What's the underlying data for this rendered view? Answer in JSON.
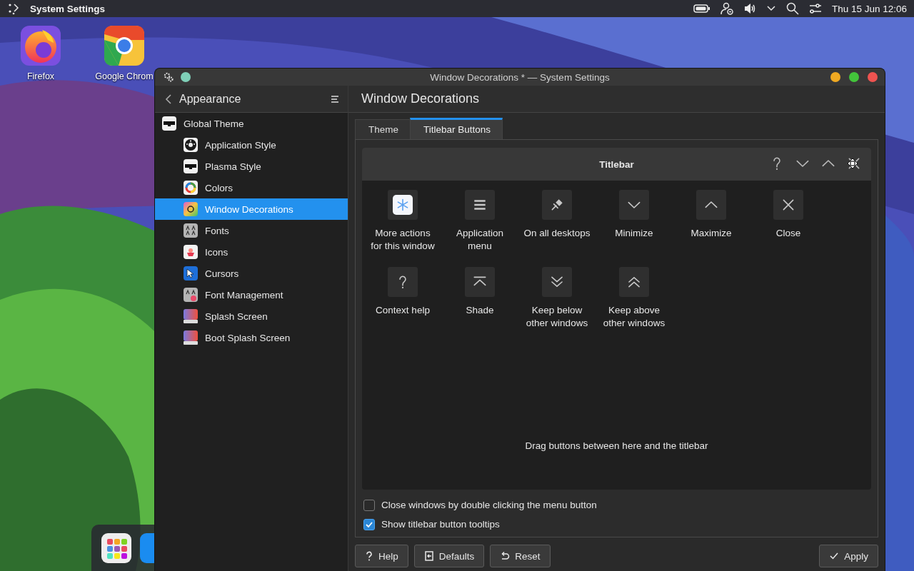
{
  "panel": {
    "app_title": "System Settings",
    "clock": "Thu 15 Jun 12:06"
  },
  "desktop_icons": [
    {
      "label": "Firefox",
      "kind": "firefox"
    },
    {
      "label": "Google Chrom",
      "kind": "chrome"
    }
  ],
  "window": {
    "title": "Window Decorations * — System Settings"
  },
  "sidebar": {
    "title": "Appearance",
    "items": [
      {
        "label": "Global Theme",
        "kind": "global",
        "selected": false,
        "children": [
          {
            "label": "Application Style",
            "kind": "appstyle",
            "selected": false
          },
          {
            "label": "Plasma Style",
            "kind": "global",
            "selected": false
          },
          {
            "label": "Colors",
            "kind": "colors",
            "selected": false
          },
          {
            "label": "Window Decorations",
            "kind": "decorations",
            "selected": true
          },
          {
            "label": "Fonts",
            "kind": "fonts",
            "selected": false
          },
          {
            "label": "Icons",
            "kind": "icons",
            "selected": false
          },
          {
            "label": "Cursors",
            "kind": "cursors",
            "selected": false
          },
          {
            "label": "Font Management",
            "kind": "fontmgmt",
            "selected": false
          },
          {
            "label": "Splash Screen",
            "kind": "splash",
            "selected": false
          },
          {
            "label": "Boot Splash Screen",
            "kind": "splash",
            "selected": false
          }
        ]
      }
    ]
  },
  "page": {
    "heading": "Window Decorations",
    "tabs": [
      {
        "label": "Theme",
        "selected": false
      },
      {
        "label": "Titlebar Buttons",
        "selected": true
      }
    ],
    "titlebar": {
      "title": "Titlebar",
      "buttons": [
        {
          "kind": "help"
        },
        {
          "kind": "minimize"
        },
        {
          "kind": "maximize"
        },
        {
          "kind": "close"
        }
      ]
    },
    "available_buttons": [
      {
        "label": "More actions for this window",
        "kind": "menu"
      },
      {
        "label": "Application menu",
        "kind": "appmenu"
      },
      {
        "label": "On all desktops",
        "kind": "pin"
      },
      {
        "label": "Minimize",
        "kind": "minimize"
      },
      {
        "label": "Maximize",
        "kind": "maximize"
      },
      {
        "label": "Close",
        "kind": "close"
      },
      {
        "label": "Context help",
        "kind": "help"
      },
      {
        "label": "Shade",
        "kind": "shade"
      },
      {
        "label": "Keep below other windows",
        "kind": "below"
      },
      {
        "label": "Keep above other windows",
        "kind": "above"
      }
    ],
    "hint": "Drag buttons between here and the titlebar",
    "options": [
      {
        "label": "Close windows by double clicking the menu button",
        "checked": false
      },
      {
        "label": "Show titlebar button tooltips",
        "checked": true
      }
    ]
  },
  "buttons": [
    {
      "label": "Help",
      "kind": "help"
    },
    {
      "label": "Defaults",
      "kind": "defaults"
    },
    {
      "label": "Reset",
      "kind": "reset"
    },
    {
      "label": "Apply",
      "kind": "apply"
    }
  ]
}
